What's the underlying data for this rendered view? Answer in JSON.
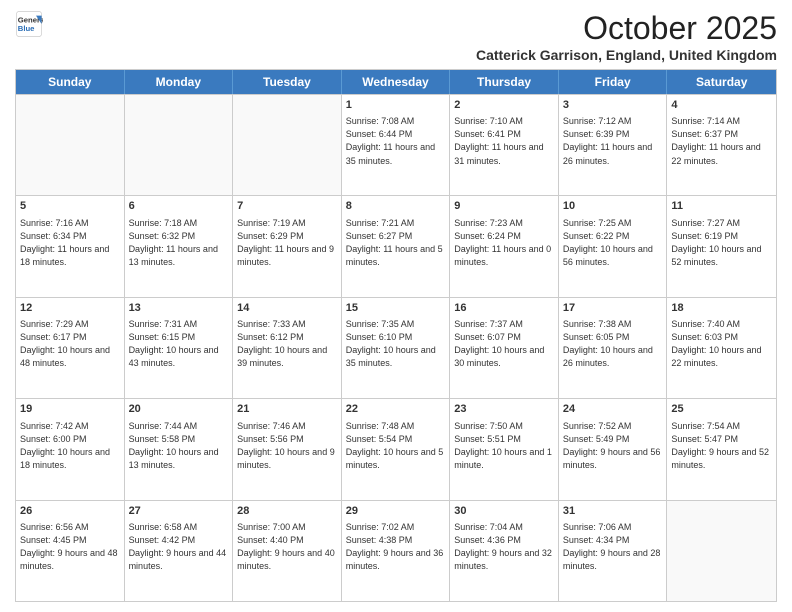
{
  "logo": {
    "line1": "General",
    "line2": "Blue"
  },
  "header": {
    "month": "October 2025",
    "location": "Catterick Garrison, England, United Kingdom"
  },
  "weekdays": [
    "Sunday",
    "Monday",
    "Tuesday",
    "Wednesday",
    "Thursday",
    "Friday",
    "Saturday"
  ],
  "weeks": [
    [
      {
        "day": "",
        "text": "",
        "empty": true
      },
      {
        "day": "",
        "text": "",
        "empty": true
      },
      {
        "day": "",
        "text": "",
        "empty": true
      },
      {
        "day": "1",
        "text": "Sunrise: 7:08 AM\nSunset: 6:44 PM\nDaylight: 11 hours\nand 35 minutes.",
        "empty": false
      },
      {
        "day": "2",
        "text": "Sunrise: 7:10 AM\nSunset: 6:41 PM\nDaylight: 11 hours\nand 31 minutes.",
        "empty": false
      },
      {
        "day": "3",
        "text": "Sunrise: 7:12 AM\nSunset: 6:39 PM\nDaylight: 11 hours\nand 26 minutes.",
        "empty": false
      },
      {
        "day": "4",
        "text": "Sunrise: 7:14 AM\nSunset: 6:37 PM\nDaylight: 11 hours\nand 22 minutes.",
        "empty": false
      }
    ],
    [
      {
        "day": "5",
        "text": "Sunrise: 7:16 AM\nSunset: 6:34 PM\nDaylight: 11 hours\nand 18 minutes.",
        "empty": false
      },
      {
        "day": "6",
        "text": "Sunrise: 7:18 AM\nSunset: 6:32 PM\nDaylight: 11 hours\nand 13 minutes.",
        "empty": false
      },
      {
        "day": "7",
        "text": "Sunrise: 7:19 AM\nSunset: 6:29 PM\nDaylight: 11 hours\nand 9 minutes.",
        "empty": false
      },
      {
        "day": "8",
        "text": "Sunrise: 7:21 AM\nSunset: 6:27 PM\nDaylight: 11 hours\nand 5 minutes.",
        "empty": false
      },
      {
        "day": "9",
        "text": "Sunrise: 7:23 AM\nSunset: 6:24 PM\nDaylight: 11 hours\nand 0 minutes.",
        "empty": false
      },
      {
        "day": "10",
        "text": "Sunrise: 7:25 AM\nSunset: 6:22 PM\nDaylight: 10 hours\nand 56 minutes.",
        "empty": false
      },
      {
        "day": "11",
        "text": "Sunrise: 7:27 AM\nSunset: 6:19 PM\nDaylight: 10 hours\nand 52 minutes.",
        "empty": false
      }
    ],
    [
      {
        "day": "12",
        "text": "Sunrise: 7:29 AM\nSunset: 6:17 PM\nDaylight: 10 hours\nand 48 minutes.",
        "empty": false
      },
      {
        "day": "13",
        "text": "Sunrise: 7:31 AM\nSunset: 6:15 PM\nDaylight: 10 hours\nand 43 minutes.",
        "empty": false
      },
      {
        "day": "14",
        "text": "Sunrise: 7:33 AM\nSunset: 6:12 PM\nDaylight: 10 hours\nand 39 minutes.",
        "empty": false
      },
      {
        "day": "15",
        "text": "Sunrise: 7:35 AM\nSunset: 6:10 PM\nDaylight: 10 hours\nand 35 minutes.",
        "empty": false
      },
      {
        "day": "16",
        "text": "Sunrise: 7:37 AM\nSunset: 6:07 PM\nDaylight: 10 hours\nand 30 minutes.",
        "empty": false
      },
      {
        "day": "17",
        "text": "Sunrise: 7:38 AM\nSunset: 6:05 PM\nDaylight: 10 hours\nand 26 minutes.",
        "empty": false
      },
      {
        "day": "18",
        "text": "Sunrise: 7:40 AM\nSunset: 6:03 PM\nDaylight: 10 hours\nand 22 minutes.",
        "empty": false
      }
    ],
    [
      {
        "day": "19",
        "text": "Sunrise: 7:42 AM\nSunset: 6:00 PM\nDaylight: 10 hours\nand 18 minutes.",
        "empty": false
      },
      {
        "day": "20",
        "text": "Sunrise: 7:44 AM\nSunset: 5:58 PM\nDaylight: 10 hours\nand 13 minutes.",
        "empty": false
      },
      {
        "day": "21",
        "text": "Sunrise: 7:46 AM\nSunset: 5:56 PM\nDaylight: 10 hours\nand 9 minutes.",
        "empty": false
      },
      {
        "day": "22",
        "text": "Sunrise: 7:48 AM\nSunset: 5:54 PM\nDaylight: 10 hours\nand 5 minutes.",
        "empty": false
      },
      {
        "day": "23",
        "text": "Sunrise: 7:50 AM\nSunset: 5:51 PM\nDaylight: 10 hours\nand 1 minute.",
        "empty": false
      },
      {
        "day": "24",
        "text": "Sunrise: 7:52 AM\nSunset: 5:49 PM\nDaylight: 9 hours\nand 56 minutes.",
        "empty": false
      },
      {
        "day": "25",
        "text": "Sunrise: 7:54 AM\nSunset: 5:47 PM\nDaylight: 9 hours\nand 52 minutes.",
        "empty": false
      }
    ],
    [
      {
        "day": "26",
        "text": "Sunrise: 6:56 AM\nSunset: 4:45 PM\nDaylight: 9 hours\nand 48 minutes.",
        "empty": false
      },
      {
        "day": "27",
        "text": "Sunrise: 6:58 AM\nSunset: 4:42 PM\nDaylight: 9 hours\nand 44 minutes.",
        "empty": false
      },
      {
        "day": "28",
        "text": "Sunrise: 7:00 AM\nSunset: 4:40 PM\nDaylight: 9 hours\nand 40 minutes.",
        "empty": false
      },
      {
        "day": "29",
        "text": "Sunrise: 7:02 AM\nSunset: 4:38 PM\nDaylight: 9 hours\nand 36 minutes.",
        "empty": false
      },
      {
        "day": "30",
        "text": "Sunrise: 7:04 AM\nSunset: 4:36 PM\nDaylight: 9 hours\nand 32 minutes.",
        "empty": false
      },
      {
        "day": "31",
        "text": "Sunrise: 7:06 AM\nSunset: 4:34 PM\nDaylight: 9 hours\nand 28 minutes.",
        "empty": false
      },
      {
        "day": "",
        "text": "",
        "empty": true
      }
    ]
  ]
}
